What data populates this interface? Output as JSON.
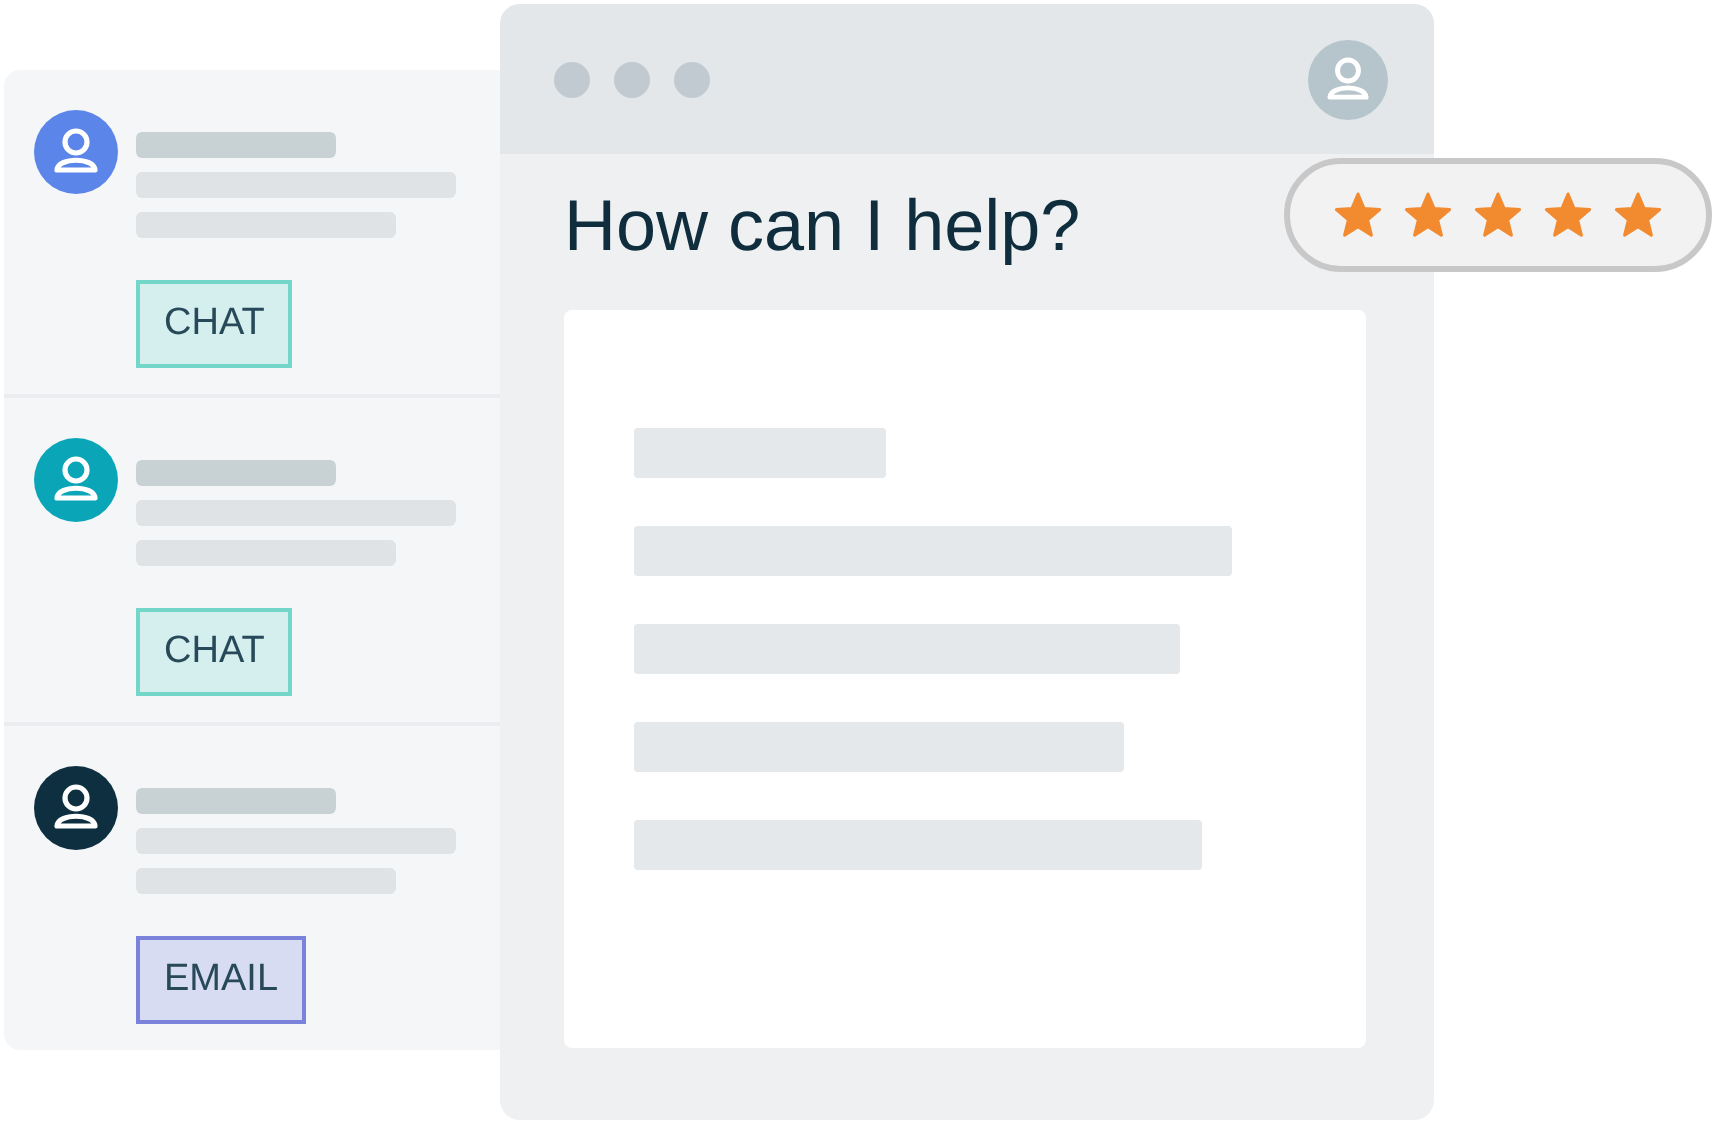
{
  "conversations": [
    {
      "color": "#5b85e8",
      "channel": {
        "kind": "chat",
        "label": "CHAT"
      }
    },
    {
      "color": "#0aa6b8",
      "channel": {
        "kind": "chat",
        "label": "CHAT"
      }
    },
    {
      "color": "#0d2f40",
      "channel": {
        "kind": "email",
        "label": "EMAIL"
      }
    }
  ],
  "window": {
    "title": "How can I help?"
  },
  "rating": {
    "stars": 5
  }
}
